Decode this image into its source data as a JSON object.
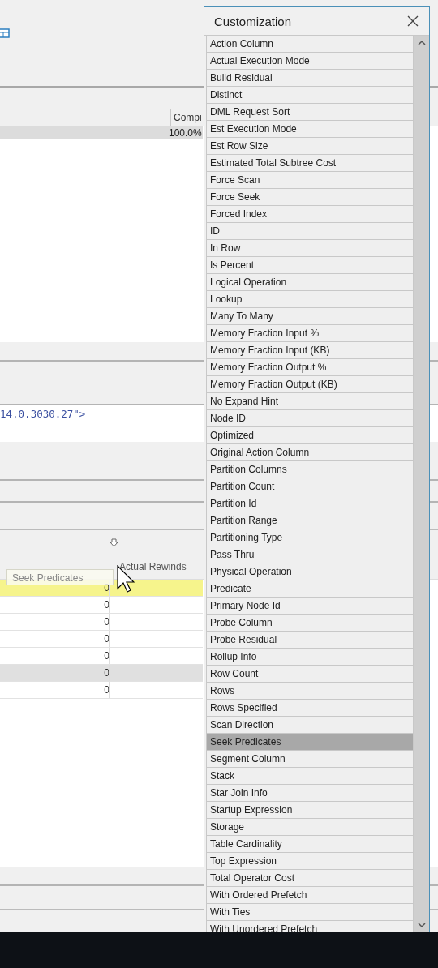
{
  "plan_header": {
    "column_1": "Compi",
    "percent": "100.0%"
  },
  "xml_text": "14.0.3030.27\">",
  "grid": {
    "drag_label": "Seek Predicates",
    "column_header": "Actual Rewinds",
    "rows": [
      {
        "value": "0",
        "selected": true,
        "shaded": false
      },
      {
        "value": "0",
        "selected": false,
        "shaded": false
      },
      {
        "value": "0",
        "selected": false,
        "shaded": false
      },
      {
        "value": "0",
        "selected": false,
        "shaded": false
      },
      {
        "value": "0",
        "selected": false,
        "shaded": false
      },
      {
        "value": "0",
        "selected": false,
        "shaded": true
      },
      {
        "value": "0",
        "selected": false,
        "shaded": false
      }
    ]
  },
  "customization": {
    "title": "Customization",
    "items": [
      {
        "label": "Action Column",
        "selected": false
      },
      {
        "label": "Actual Execution Mode",
        "selected": false
      },
      {
        "label": "Build Residual",
        "selected": false
      },
      {
        "label": "Distinct",
        "selected": false
      },
      {
        "label": "DML Request Sort",
        "selected": false
      },
      {
        "label": "Est Execution Mode",
        "selected": false
      },
      {
        "label": "Est Row Size",
        "selected": false
      },
      {
        "label": "Estimated Total Subtree Cost",
        "selected": false
      },
      {
        "label": "Force Scan",
        "selected": false
      },
      {
        "label": "Force Seek",
        "selected": false
      },
      {
        "label": "Forced Index",
        "selected": false
      },
      {
        "label": "ID",
        "selected": false
      },
      {
        "label": "In Row",
        "selected": false
      },
      {
        "label": "Is Percent",
        "selected": false
      },
      {
        "label": "Logical Operation",
        "selected": false
      },
      {
        "label": "Lookup",
        "selected": false
      },
      {
        "label": "Many To Many",
        "selected": false
      },
      {
        "label": "Memory Fraction Input %",
        "selected": false
      },
      {
        "label": "Memory Fraction Input (KB)",
        "selected": false
      },
      {
        "label": "Memory Fraction Output %",
        "selected": false
      },
      {
        "label": "Memory Fraction Output (KB)",
        "selected": false
      },
      {
        "label": "No Expand Hint",
        "selected": false
      },
      {
        "label": "Node ID",
        "selected": false
      },
      {
        "label": "Optimized",
        "selected": false
      },
      {
        "label": "Original Action Column",
        "selected": false
      },
      {
        "label": "Partition Columns",
        "selected": false
      },
      {
        "label": "Partition Count",
        "selected": false
      },
      {
        "label": "Partition Id",
        "selected": false
      },
      {
        "label": "Partition Range",
        "selected": false
      },
      {
        "label": "Partitioning Type",
        "selected": false
      },
      {
        "label": "Pass Thru",
        "selected": false
      },
      {
        "label": "Physical Operation",
        "selected": false
      },
      {
        "label": "Predicate",
        "selected": false
      },
      {
        "label": "Primary Node Id",
        "selected": false
      },
      {
        "label": "Probe Column",
        "selected": false
      },
      {
        "label": "Probe Residual",
        "selected": false
      },
      {
        "label": "Rollup Info",
        "selected": false
      },
      {
        "label": "Row Count",
        "selected": false
      },
      {
        "label": "Rows",
        "selected": false
      },
      {
        "label": "Rows Specified",
        "selected": false
      },
      {
        "label": "Scan Direction",
        "selected": false
      },
      {
        "label": "Seek Predicates",
        "selected": true
      },
      {
        "label": "Segment Column",
        "selected": false
      },
      {
        "label": "Stack",
        "selected": false
      },
      {
        "label": "Star Join Info",
        "selected": false
      },
      {
        "label": "Startup Expression",
        "selected": false
      },
      {
        "label": "Storage",
        "selected": false
      },
      {
        "label": "Table Cardinality",
        "selected": false
      },
      {
        "label": "Top Expression",
        "selected": false
      },
      {
        "label": "Total Operator Cost",
        "selected": false
      },
      {
        "label": "With Ordered Prefetch",
        "selected": false
      },
      {
        "label": "With Ties",
        "selected": false
      },
      {
        "label": "With Unordered Prefetch",
        "selected": false
      }
    ]
  }
}
